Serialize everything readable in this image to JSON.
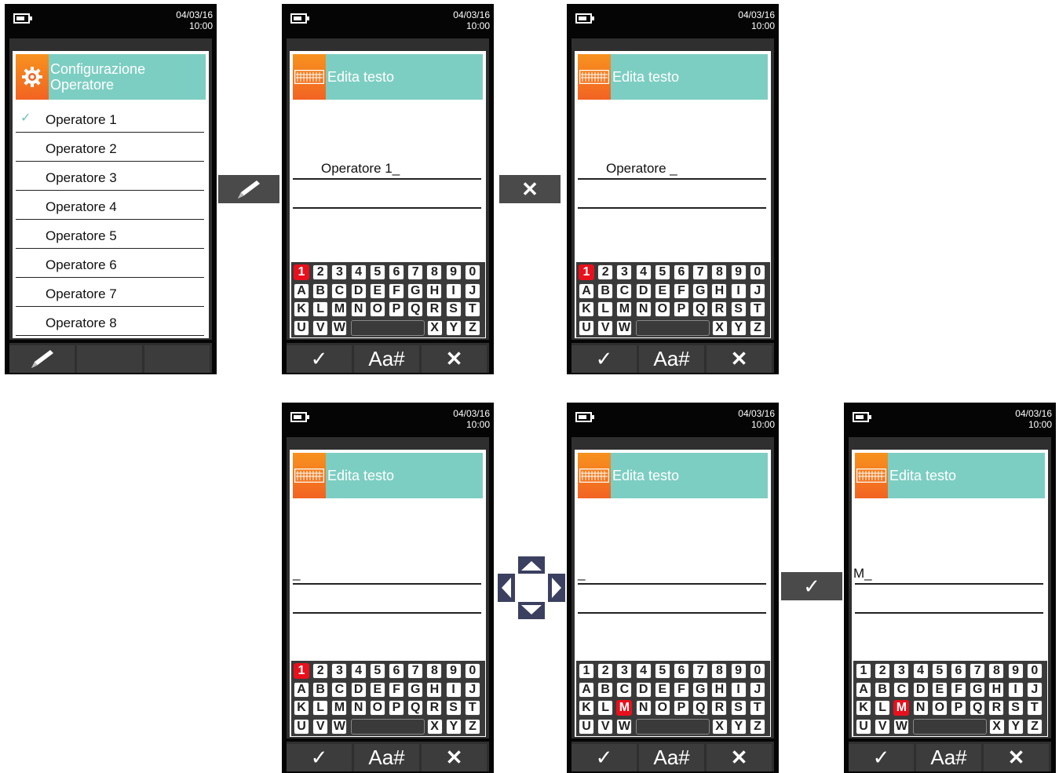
{
  "status": {
    "date": "04/03/16",
    "time": "10:00"
  },
  "menu_screen": {
    "title_line1": "Configurazione",
    "title_line2": "Operatore",
    "items": [
      "Operatore 1",
      "Operatore 2",
      "Operatore 3",
      "Operatore 4",
      "Operatore 5",
      "Operatore 6",
      "Operatore 7",
      "Operatore 8"
    ],
    "selected_index": 0,
    "check_glyph": "✓",
    "softkeys": [
      "pencil-icon",
      "",
      ""
    ]
  },
  "editor": {
    "title": "Edita testo",
    "softkeys": [
      "✓",
      "Aa#",
      "✕"
    ],
    "keyboard_rows": [
      [
        "1",
        "2",
        "3",
        "4",
        "5",
        "6",
        "7",
        "8",
        "9",
        "0"
      ],
      [
        "A",
        "B",
        "C",
        "D",
        "E",
        "F",
        "G",
        "H",
        "I",
        "J"
      ],
      [
        "K",
        "L",
        "M",
        "N",
        "O",
        "P",
        "Q",
        "R",
        "S",
        "T"
      ],
      [
        "U",
        "V",
        "W",
        "",
        "X",
        "Y",
        "Z"
      ]
    ]
  },
  "transitions": {
    "edit": "pencil-icon",
    "delete": "✕",
    "navigate": "dpad-icon",
    "confirm": "✓"
  },
  "screens": [
    {
      "id": "s2",
      "text": "Operatore 1_",
      "selected_key": "1"
    },
    {
      "id": "s3",
      "text": "Operatore _",
      "selected_key": "1"
    },
    {
      "id": "s4",
      "text": "_",
      "selected_key": "1"
    },
    {
      "id": "s5",
      "text": "_",
      "selected_key": "M"
    },
    {
      "id": "s6",
      "text": "M_",
      "selected_key": "M"
    }
  ],
  "colors": {
    "header_teal": "#7dcec2",
    "icon_orange": "#f26322",
    "selected_key_red": "#e8101c",
    "dpad_navy": "#3b4060"
  }
}
